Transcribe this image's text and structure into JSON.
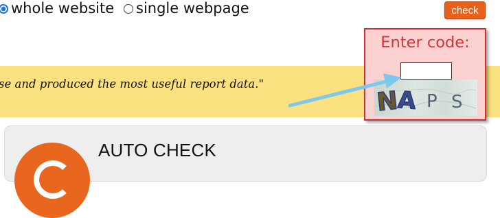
{
  "scope": {
    "options": [
      {
        "label": "whole website",
        "checked": true
      },
      {
        "label": "single webpage",
        "checked": false
      }
    ]
  },
  "toolbar": {
    "check_label": "check",
    "accent_color": "#e8611a"
  },
  "quote": {
    "text": "se and produced the most useful report data.\"",
    "band_color": "#fbe17f"
  },
  "captcha": {
    "label": "Enter code:",
    "input_value": "",
    "image_text": "NAPS",
    "box_color": "#fbd0d0",
    "label_color": "#d0353a"
  },
  "card": {
    "title": "AUTO CHECK",
    "logo_icon": "refresh-icon"
  },
  "annotation": {
    "arrow_color": "#7cc8ee"
  }
}
